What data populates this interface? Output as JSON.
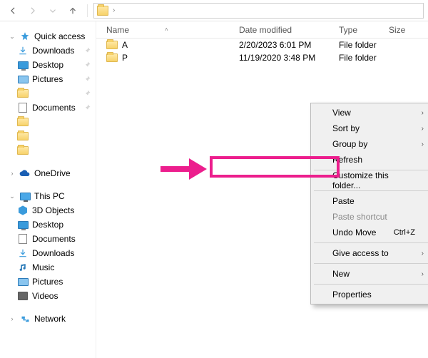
{
  "nav": {
    "back": "←",
    "forward": "→",
    "up": "↑"
  },
  "columns": {
    "name": "Name",
    "date": "Date modified",
    "type": "Type",
    "size": "Size"
  },
  "rows": [
    {
      "name": "A",
      "date": "2/20/2023 6:01 PM",
      "type": "File folder"
    },
    {
      "name": "P",
      "date": "11/19/2020 3:48 PM",
      "type": "File folder"
    }
  ],
  "sidebar": {
    "quick": "Quick access",
    "downloads": "Downloads",
    "desktop": "Desktop",
    "pictures": "Pictures",
    "documents": "Documents",
    "onedrive": "OneDrive",
    "thispc": "This PC",
    "objects3d": "3D Objects",
    "desktop2": "Desktop",
    "documents2": "Documents",
    "downloads2": "Downloads",
    "music": "Music",
    "pictures2": "Pictures",
    "videos": "Videos",
    "network": "Network"
  },
  "ctx": {
    "view": "View",
    "sort": "Sort by",
    "group": "Group by",
    "refresh": "Refresh",
    "customize": "Customize this folder...",
    "paste": "Paste",
    "paste_shortcut": "Paste shortcut",
    "undo": "Undo Move",
    "undo_key": "Ctrl+Z",
    "access": "Give access to",
    "new": "New",
    "properties": "Properties"
  }
}
